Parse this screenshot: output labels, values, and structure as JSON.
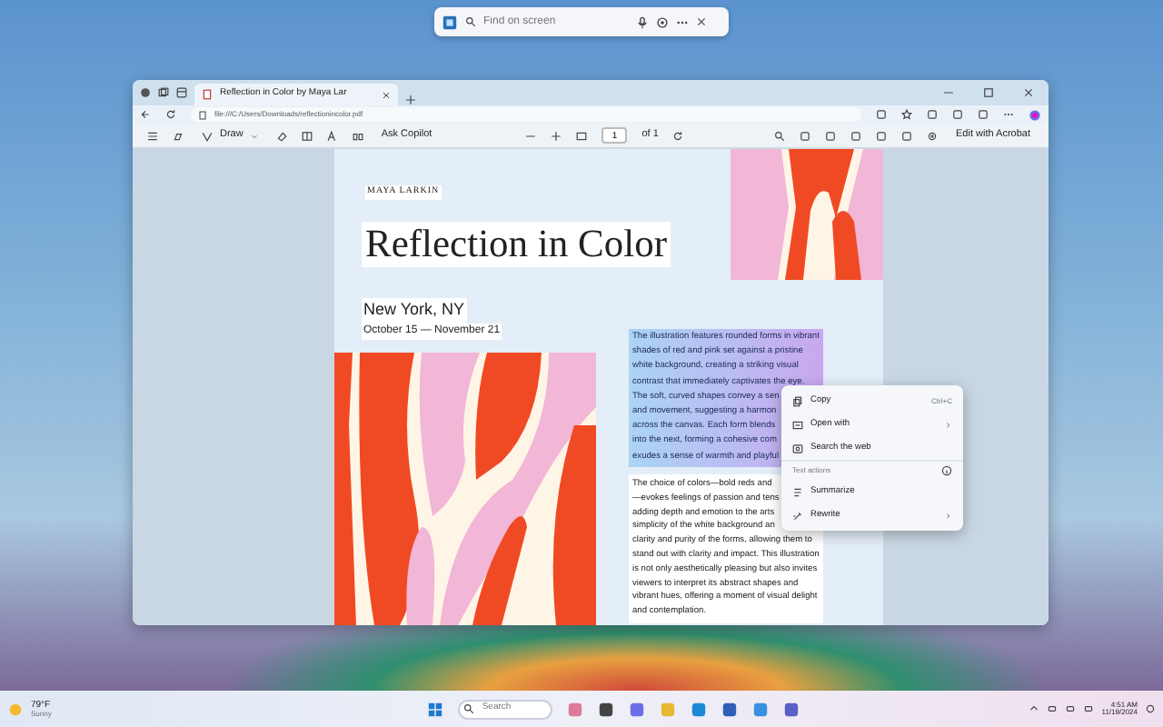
{
  "search_bar": {
    "placeholder": "Find on screen"
  },
  "browser": {
    "tab_title": "Reflection in Color by Maya Lar",
    "address": "file:///C:/Users/Downloads/reflectionincolor.pdf"
  },
  "pdf_toolbar": {
    "draw_label": "Draw",
    "ask_label": "Ask Copilot",
    "page": "1",
    "page_count": "of 1",
    "edit_label": "Edit with Acrobat"
  },
  "document": {
    "author": "MAYA LARKIN",
    "title": "Reflection in Color",
    "city": "New York, NY",
    "dates": "October 15 — November 21",
    "selected_paragraph": "The illustration features rounded forms in vibrant\nshades of red and pink set against a pristine\nwhite background, creating a striking visual\ncontrast that immediately captivates the eye.\nThe soft, curved shapes convey a sen\nand movement, suggesting a harmon\nacross the canvas. Each form blends\ninto the next, forming a cohesive com\nexudes a sense of warmth and playful",
    "paragraph": "The choice of colors—bold reds and\n—evokes feelings of passion and tens\nadding depth and emotion to the arts\nsimplicity of the white background an\nclarity and purity of the forms, allowing them to\nstand out with clarity and impact. This illustration\nis not only aesthetically pleasing but also invites\nviewers to interpret its abstract shapes and\nvibrant hues, offering a moment of visual delight\nand contemplation."
  },
  "context_menu": {
    "items": [
      {
        "kind": "item",
        "label": "Copy",
        "shortcut": "Ctrl+C"
      },
      {
        "kind": "submenu",
        "label": "Open with"
      },
      {
        "kind": "item",
        "label": "Search the web"
      },
      {
        "kind": "section",
        "label": "Text actions"
      },
      {
        "kind": "item",
        "label": "Summarize"
      },
      {
        "kind": "submenu",
        "label": "Rewrite"
      }
    ]
  },
  "taskbar": {
    "temperature": "79°F",
    "condition": "Sunny",
    "search_placeholder": "Search",
    "time": "4:51 AM",
    "date": "11/19/2024"
  }
}
